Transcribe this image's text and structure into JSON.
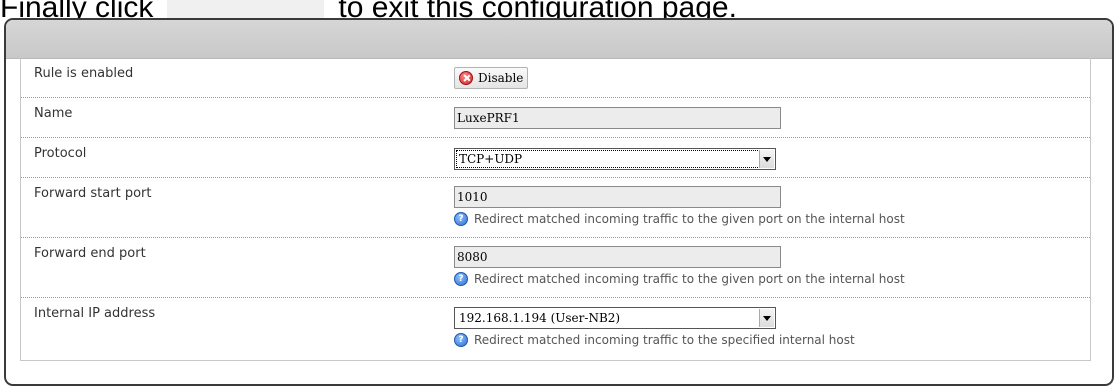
{
  "caption": {
    "prefix": "Finally click",
    "suffix": "to exit this configuration page."
  },
  "form": {
    "enabled": {
      "label": "Rule is enabled",
      "button_label": "Disable"
    },
    "name": {
      "label": "Name",
      "value": "LuxePRF1"
    },
    "protocol": {
      "label": "Protocol",
      "value": "TCP+UDP"
    },
    "start_port": {
      "label": "Forward start port",
      "value": "1010",
      "help": "Redirect matched incoming traffic to the given port on the internal host"
    },
    "end_port": {
      "label": "Forward end port",
      "value": "8080",
      "help": "Redirect matched incoming traffic to the given port on the internal host"
    },
    "internal_ip": {
      "label": "Internal IP address",
      "value": "192.168.1.194 (User-NB2)",
      "help": "Redirect matched incoming traffic to the specified internal host"
    }
  },
  "icons": {
    "disable": "close-circle-icon",
    "help": "help-icon",
    "dropdown": "chevron-down-icon"
  },
  "colors": {
    "disable_icon": "#d42020",
    "help_icon": "#2c6ed0",
    "header": "#cccccc"
  }
}
